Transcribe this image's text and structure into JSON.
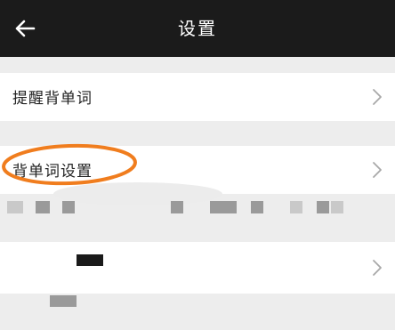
{
  "header": {
    "title": "设置",
    "back_icon": "arrow-left-icon"
  },
  "settings": {
    "items": [
      {
        "label": "提醒背单词",
        "icon": "chevron-right-icon"
      },
      {
        "label": "背单词设置",
        "icon": "chevron-right-icon",
        "highlighted": true
      },
      {
        "label": "",
        "icon": "chevron-right-icon"
      }
    ]
  },
  "colors": {
    "header_bg": "#1b1b1b",
    "page_bg": "#ededed",
    "highlight_ring": "#f07d1e",
    "chevron": "#a8a8a8"
  }
}
